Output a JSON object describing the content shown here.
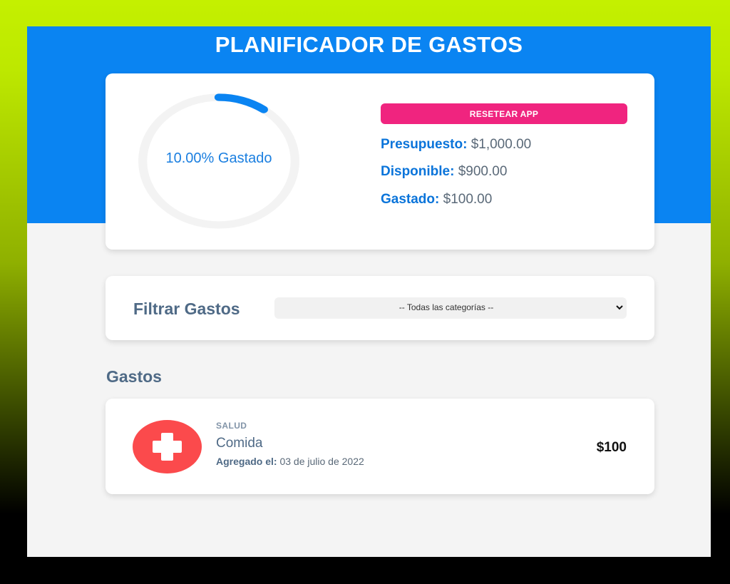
{
  "header": {
    "title": "PLANIFICADOR DE GASTOS"
  },
  "budget": {
    "progress_percent": 10,
    "progress_text": "10.00% Gastado",
    "reset_label": "RESETEAR APP",
    "presupuesto_label": "Presupuesto:",
    "presupuesto_value": "$1,000.00",
    "disponible_label": "Disponible:",
    "disponible_value": "$900.00",
    "gastado_label": "Gastado:",
    "gastado_value": "$100.00"
  },
  "filter": {
    "label": "Filtrar Gastos",
    "selected": "-- Todas las categorías --"
  },
  "expenses": {
    "heading": "Gastos",
    "items": [
      {
        "icon": "health-cross-icon",
        "category": "SALUD",
        "name": "Comida",
        "date_label": "Agregado el:",
        "date": "03 de julio de 2022",
        "amount": "$100"
      }
    ]
  },
  "colors": {
    "primary_blue": "#0a84f2",
    "reset_pink": "#f0247f",
    "health_red": "#fb4a4c",
    "track_gray": "#f3f3f3"
  }
}
